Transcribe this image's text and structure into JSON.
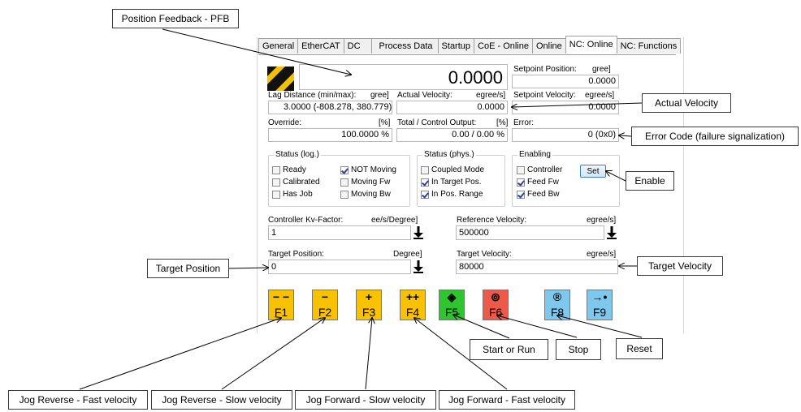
{
  "tabs": [
    "General",
    "EtherCAT",
    "DC",
    "Process Data",
    "Startup",
    "CoE - Online",
    "Online",
    "NC: Online",
    "NC: Functions"
  ],
  "active_tab": "NC: Online",
  "position": {
    "value": "0.0000"
  },
  "setpoint_position": {
    "label": "Setpoint Position:",
    "unit": "gree]",
    "value": "0.0000"
  },
  "lag_distance": {
    "label": "Lag Distance (min/max):",
    "unit": "gree]",
    "value": "3.0000  (-808.278, 380.779)"
  },
  "actual_velocity": {
    "label": "Actual Velocity:",
    "unit": "egree/s]",
    "value": "0.0000"
  },
  "setpoint_velocity": {
    "label": "Setpoint Velocity:",
    "unit": "egree/s]",
    "value": "0.0000"
  },
  "override": {
    "label": "Override:",
    "unit": "[%]",
    "value": "100.0000 %"
  },
  "total_output": {
    "label": "Total / Control Output:",
    "unit": "[%]",
    "value": "0.00 /  0.00 %"
  },
  "error": {
    "label": "Error:",
    "value": "0 (0x0)"
  },
  "status_log": {
    "title": "Status (log.)",
    "items": [
      {
        "label": "Ready",
        "checked": false
      },
      {
        "label": "Calibrated",
        "checked": false
      },
      {
        "label": "Has Job",
        "checked": false
      },
      {
        "label": "NOT Moving",
        "checked": true
      },
      {
        "label": "Moving Fw",
        "checked": false
      },
      {
        "label": "Moving Bw",
        "checked": false
      }
    ]
  },
  "status_phys": {
    "title": "Status (phys.)",
    "items": [
      {
        "label": "Coupled Mode",
        "checked": false
      },
      {
        "label": "In Target Pos.",
        "checked": true
      },
      {
        "label": "In Pos. Range",
        "checked": true
      }
    ]
  },
  "enabling": {
    "title": "Enabling",
    "items": [
      {
        "label": "Controller",
        "checked": false
      },
      {
        "label": "Feed Fw",
        "checked": true
      },
      {
        "label": "Feed Bw",
        "checked": true
      }
    ],
    "set_label": "Set"
  },
  "kv_factor": {
    "label": "Controller Kv-Factor:",
    "unit": "ee/s/Degree]",
    "value": "1"
  },
  "reference_velocity": {
    "label": "Reference Velocity:",
    "unit": "egree/s]",
    "value": "500000"
  },
  "target_position": {
    "label": "Target Position:",
    "unit": "Degree]",
    "value": "0"
  },
  "target_velocity": {
    "label": "Target Velocity:",
    "unit": "egree/s]",
    "value": "80000"
  },
  "fkeys": [
    {
      "sym": "− −",
      "num": "F1",
      "color": "#f8c200"
    },
    {
      "sym": "−",
      "num": "F2",
      "color": "#f8c200"
    },
    {
      "sym": "+",
      "num": "F3",
      "color": "#f8c200"
    },
    {
      "sym": "++",
      "num": "F4",
      "color": "#f8c200"
    },
    {
      "sym": "◈",
      "num": "F5",
      "color": "#2ec52e"
    },
    {
      "sym": "⊚",
      "num": "F6",
      "color": "#ee5a4a"
    },
    {
      "sym": "®",
      "num": "F8",
      "color": "#7ec8ee"
    },
    {
      "sym": "→•",
      "num": "F9",
      "color": "#7ec8ee"
    }
  ],
  "callouts": {
    "position_feedback": "Position Feedback - PFB",
    "actual_velocity": "Actual Velocity",
    "error_code": "Error Code (failure signalization)",
    "enable": "Enable",
    "target_position": "Target Position",
    "target_velocity": "Target Velocity",
    "start_run": "Start or Run",
    "stop": "Stop",
    "reset": "Reset",
    "jog_rev_fast": "Jog Reverse - Fast velocity",
    "jog_rev_slow": "Jog Reverse - Slow velocity",
    "jog_fwd_slow": "Jog Forward - Slow velocity",
    "jog_fwd_fast": "Jog Forward - Fast velocity"
  }
}
